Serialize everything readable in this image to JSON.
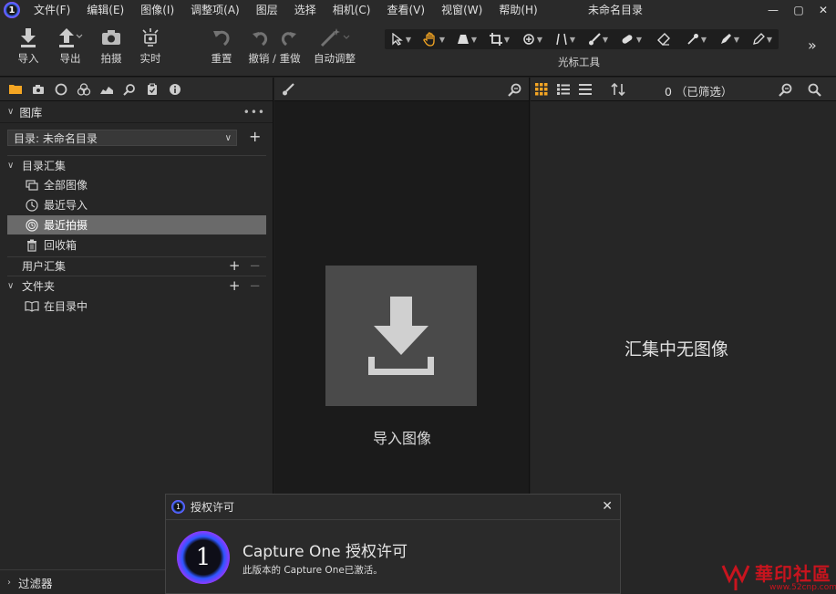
{
  "menubar": {
    "items": [
      "文件(F)",
      "编辑(E)",
      "图像(I)",
      "调整项(A)",
      "图层",
      "选择",
      "相机(C)",
      "查看(V)",
      "视窗(W)",
      "帮助(H)"
    ],
    "window_title": "未命名目录"
  },
  "toolbar": {
    "import": "导入",
    "export": "导出",
    "capture": "拍摄",
    "live": "实时",
    "reset": "重置",
    "undo_redo": "撤销 / 重做",
    "auto_adjust": "自动调整",
    "cursor_tools_label": "光标工具",
    "accent_color": "#f5a623"
  },
  "library": {
    "title": "图库",
    "catalog_select": "目录: 未命名目录",
    "catalog_collections": "目录汇集",
    "items": {
      "all_images": "全部图像",
      "recent_imports": "最近导入",
      "recent_captures": "最近拍摄",
      "trash": "回收箱"
    },
    "user_collections": "用户汇集",
    "folders": "文件夹",
    "in_catalog": "在目录中",
    "filters": "过滤器"
  },
  "viewer": {
    "import_label": "导入图像"
  },
  "browser": {
    "filter_count": "0 （已筛选）",
    "empty_message": "汇集中无图像"
  },
  "popup": {
    "header": "授权许可",
    "title": "Capture One 授权许可",
    "subtitle": "此版本的 Capture One已激活。"
  },
  "watermark": {
    "text": "華印社區",
    "url": "www.52cnp.com"
  }
}
